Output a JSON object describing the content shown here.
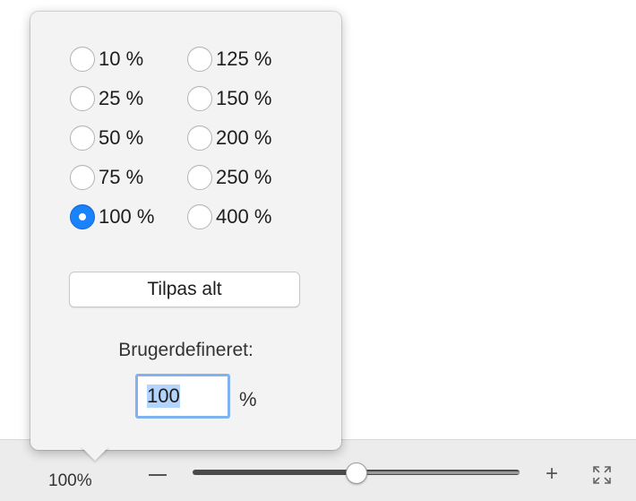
{
  "zoom_popover": {
    "options": [
      {
        "label": "10 %",
        "selected": false
      },
      {
        "label": "25 %",
        "selected": false
      },
      {
        "label": "50 %",
        "selected": false
      },
      {
        "label": "75 %",
        "selected": false
      },
      {
        "label": "100 %",
        "selected": true
      },
      {
        "label": "125 %",
        "selected": false
      },
      {
        "label": "150 %",
        "selected": false
      },
      {
        "label": "200 %",
        "selected": false
      },
      {
        "label": "250 %",
        "selected": false
      },
      {
        "label": "400 %",
        "selected": false
      }
    ],
    "fit_button_label": "Tilpas alt",
    "custom_label": "Brugerdefineret:",
    "custom_value": "100",
    "custom_unit": "%"
  },
  "statusbar": {
    "zoom_level": "100%",
    "minus_icon": "minus-icon",
    "plus_icon": "plus-icon",
    "fullscreen_icon": "fit-to-window-icon",
    "slider_level": 0.5
  },
  "colors": {
    "accent": "#1a82fb",
    "focus_ring": "#7fb2ee"
  }
}
